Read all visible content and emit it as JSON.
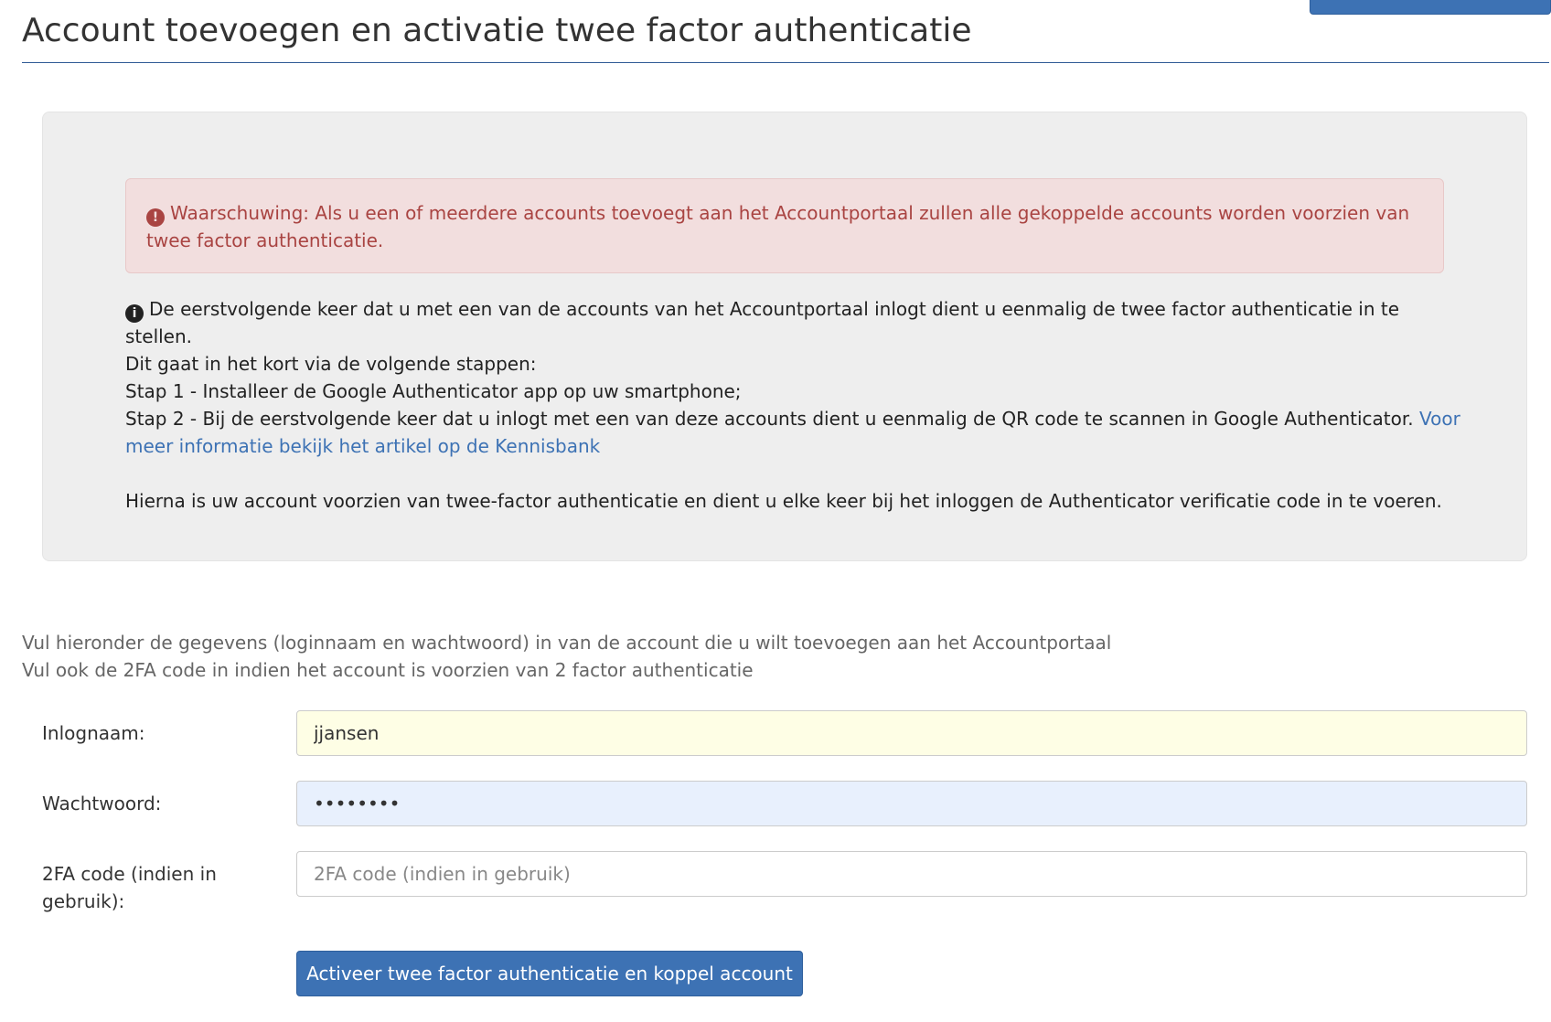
{
  "header": {
    "title": "Account toevoegen en activatie twee factor authenticatie"
  },
  "colors": {
    "primary": "#3d72b4",
    "alert_text": "#a94442",
    "alert_bg": "#f2dede",
    "well_bg": "#eeeeee"
  },
  "warning": {
    "icon": "exclamation-circle-icon",
    "text": "Waarschuwing: Als u een of meerdere accounts toevoegt aan het Accountportaal zullen alle gekoppelde accounts worden voorzien van twee factor authenticatie."
  },
  "info": {
    "icon": "info-circle-icon",
    "line1": "De eerstvolgende keer dat u met een van de accounts van het Accountportaal inlogt dient u eenmalig de twee factor authenticatie in te stellen.",
    "line2": "Dit gaat in het kort via de volgende stappen:",
    "step1": "Stap 1 - Installeer de Google Authenticator app op uw smartphone;",
    "step2": "Stap 2 - Bij de eerstvolgende keer dat u inlogt met een van deze accounts dient u eenmalig de QR code te scannen in Google Authenticator.",
    "link": "Voor meer informatie bekijk het artikel op de Kennisbank",
    "after": "Hierna is uw account voorzien van twee-factor authenticatie en dient u elke keer bij het inloggen de Authenticator verificatie code in te voeren."
  },
  "intro": {
    "line1": "Vul hieronder de gegevens (loginnaam en wachtwoord) in van de account die u wilt toevoegen aan het Accountportaal",
    "line2": "Vul ook de 2FA code in indien het account is voorzien van 2 factor authenticatie"
  },
  "form": {
    "username_label": "Inlognaam:",
    "username_value": "jjansen",
    "password_label": "Wachtwoord:",
    "password_value": "jjansen1",
    "code_label": "2FA code (indien in gebruik):",
    "code_placeholder": "2FA code (indien in gebruik)",
    "submit_label": "Activeer twee factor authenticatie en koppel account"
  }
}
